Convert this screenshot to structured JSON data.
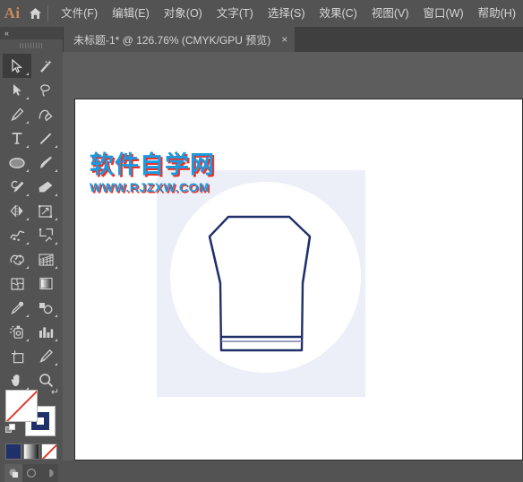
{
  "app": {
    "logo_text": "Ai",
    "logo_color": "#cb8a5b",
    "home_icon": "home-icon"
  },
  "menu": {
    "items": [
      {
        "label": "文件(F)"
      },
      {
        "label": "编辑(E)"
      },
      {
        "label": "对象(O)"
      },
      {
        "label": "文字(T)"
      },
      {
        "label": "选择(S)"
      },
      {
        "label": "效果(C)"
      },
      {
        "label": "视图(V)"
      },
      {
        "label": "窗口(W)"
      },
      {
        "label": "帮助(H)"
      }
    ]
  },
  "tabs": {
    "active": {
      "label": "未标题-1* @ 126.76% (CMYK/GPU 预览)",
      "close": "×",
      "document_name": "未标题-1",
      "modified": true,
      "zoom": "126.76%",
      "color_mode": "CMYK",
      "preview_mode": "GPU 预览"
    }
  },
  "toolpanel": {
    "collapse_arrows": "«",
    "tools": [
      {
        "name": "selection-tool",
        "active": true,
        "has_flyout": true
      },
      {
        "name": "magic-wand-tool",
        "active": false,
        "has_flyout": false
      },
      {
        "name": "direct-selection-tool",
        "active": false,
        "has_flyout": true
      },
      {
        "name": "lasso-tool",
        "active": false,
        "has_flyout": false
      },
      {
        "name": "pen-tool",
        "active": false,
        "has_flyout": true
      },
      {
        "name": "curvature-tool",
        "active": false,
        "has_flyout": false
      },
      {
        "name": "type-tool",
        "active": false,
        "has_flyout": true
      },
      {
        "name": "line-segment-tool",
        "active": false,
        "has_flyout": true
      },
      {
        "name": "ellipse-tool",
        "active": false,
        "has_flyout": true
      },
      {
        "name": "paintbrush-tool",
        "active": false,
        "has_flyout": true
      },
      {
        "name": "shaper-pencil-tool",
        "active": false,
        "has_flyout": true
      },
      {
        "name": "eraser-tool",
        "active": false,
        "has_flyout": true
      },
      {
        "name": "reflect-rotate-tool",
        "active": false,
        "has_flyout": true
      },
      {
        "name": "scale-shear-tool",
        "active": false,
        "has_flyout": true
      },
      {
        "name": "width-warp-tool",
        "active": false,
        "has_flyout": true
      },
      {
        "name": "free-transform-tool",
        "active": false,
        "has_flyout": true
      },
      {
        "name": "shape-builder-tool",
        "active": false,
        "has_flyout": true
      },
      {
        "name": "perspective-grid-tool",
        "active": false,
        "has_flyout": true
      },
      {
        "name": "mesh-tool",
        "active": false,
        "has_flyout": false
      },
      {
        "name": "gradient-tool",
        "active": false,
        "has_flyout": false
      },
      {
        "name": "eyedropper-tool",
        "active": false,
        "has_flyout": true
      },
      {
        "name": "blend-tool",
        "active": false,
        "has_flyout": true
      },
      {
        "name": "symbol-sprayer-tool",
        "active": false,
        "has_flyout": true
      },
      {
        "name": "column-graph-tool",
        "active": false,
        "has_flyout": true
      },
      {
        "name": "artboard-tool",
        "active": false,
        "has_flyout": false
      },
      {
        "name": "slice-tool",
        "active": false,
        "has_flyout": true
      },
      {
        "name": "hand-tool",
        "active": false,
        "has_flyout": true
      },
      {
        "name": "zoom-tool",
        "active": false,
        "has_flyout": false
      }
    ],
    "fill_stroke": {
      "fill_name": "fill-swatch-none",
      "fill_color": "#ffffff",
      "fill_is_none": true,
      "stroke_name": "stroke-swatch",
      "stroke_color": "#20306a",
      "swap_icon": "swap-fill-stroke-icon",
      "default_icon": "default-fill-stroke-icon"
    },
    "color_modes": [
      {
        "name": "color-mode-button",
        "color": "#20306a"
      },
      {
        "name": "gradient-mode-button",
        "color": "#ffffff"
      },
      {
        "name": "none-mode-button",
        "color": "#ffffff"
      }
    ],
    "draw_modes": [
      {
        "name": "draw-normal-button",
        "active": true
      },
      {
        "name": "draw-behind-button",
        "active": false
      },
      {
        "name": "draw-inside-button",
        "active": false
      }
    ]
  },
  "canvas": {
    "background_color": "#5d5d5d",
    "artboard_color": "#ffffff",
    "artwork": {
      "name": "vest-illustration",
      "square_color": "#eceef8",
      "circle_color": "#ffffff",
      "stroke_color": "#20306a"
    }
  },
  "watermark": {
    "line1": "软件自学网",
    "line2": "WWW.RJZXW.COM",
    "text_color": "#1a9ae0",
    "shadow_color": "#e8342c"
  }
}
